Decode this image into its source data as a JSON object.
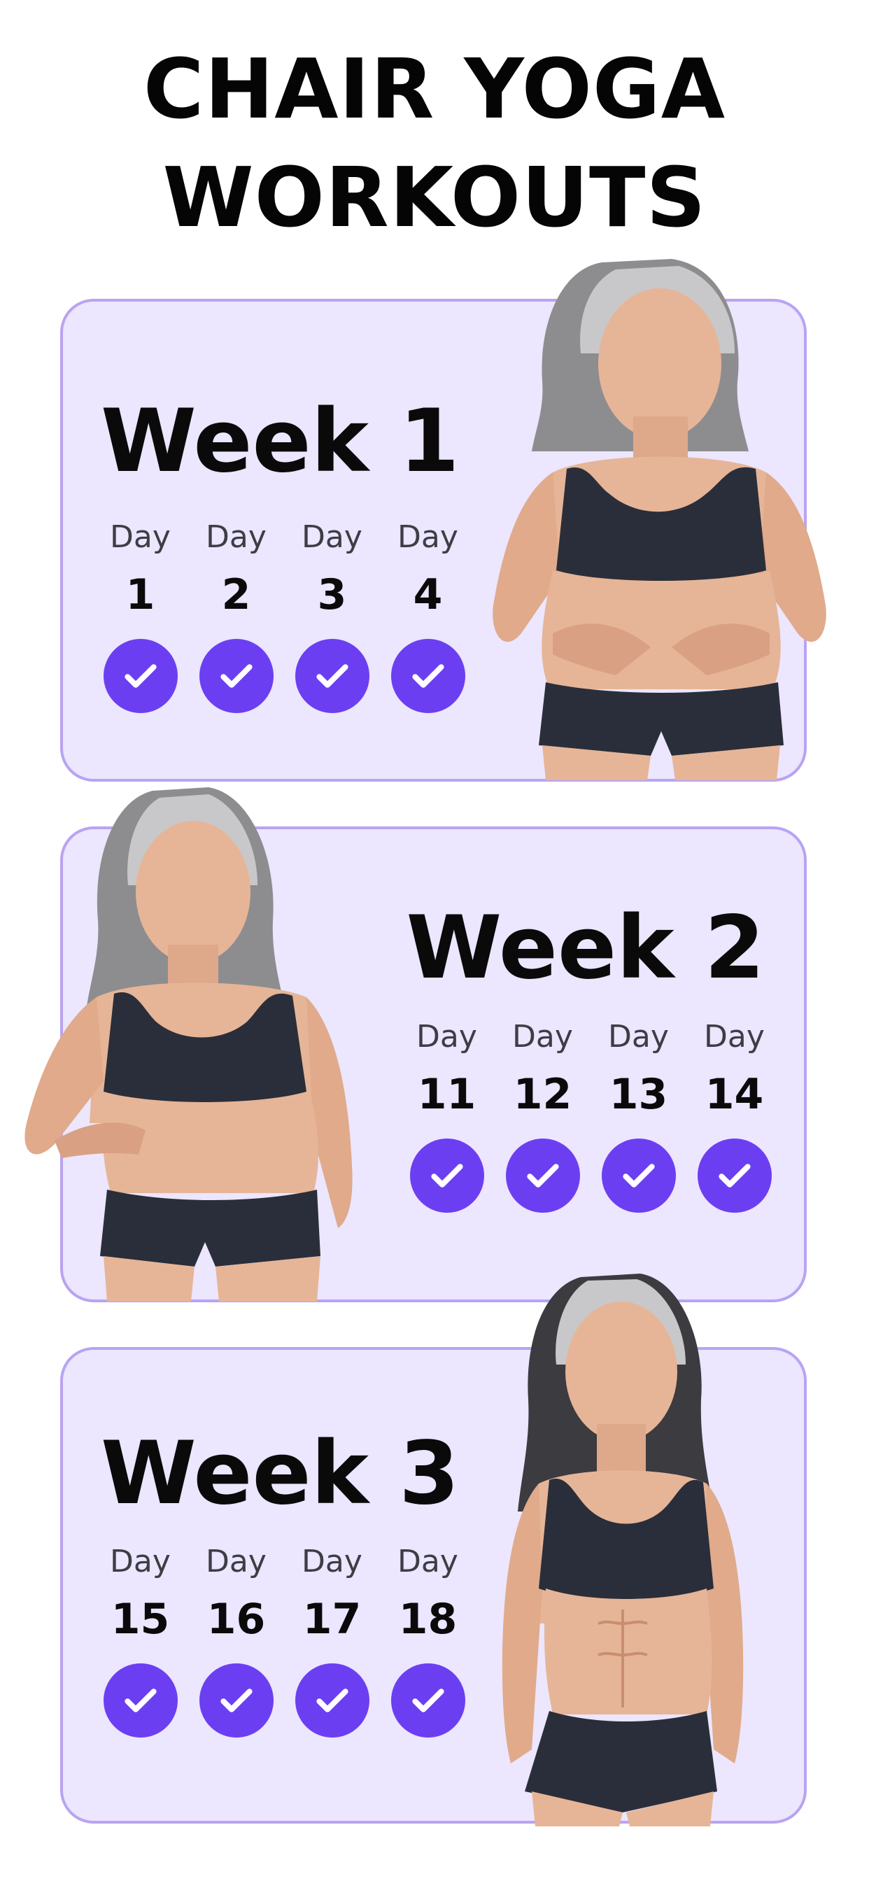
{
  "header": {
    "title_line1": "CHAIR YOGA",
    "title_line2": "WORKOUTS"
  },
  "colors": {
    "card_bg": "#ece6fe",
    "card_border": "#b9a3f2",
    "check_bg": "#6b3ff1",
    "text": "#0a0a0a"
  },
  "weeks": [
    {
      "title": "Week 1",
      "days": [
        {
          "label": "Day",
          "number": "1",
          "completed": true
        },
        {
          "label": "Day",
          "number": "2",
          "completed": true
        },
        {
          "label": "Day",
          "number": "3",
          "completed": true
        },
        {
          "label": "Day",
          "number": "4",
          "completed": true
        }
      ]
    },
    {
      "title": "Week 2",
      "days": [
        {
          "label": "Day",
          "number": "11",
          "completed": true
        },
        {
          "label": "Day",
          "number": "12",
          "completed": true
        },
        {
          "label": "Day",
          "number": "13",
          "completed": true
        },
        {
          "label": "Day",
          "number": "14",
          "completed": true
        }
      ]
    },
    {
      "title": "Week 3",
      "days": [
        {
          "label": "Day",
          "number": "15",
          "completed": true
        },
        {
          "label": "Day",
          "number": "16",
          "completed": true
        },
        {
          "label": "Day",
          "number": "17",
          "completed": true
        },
        {
          "label": "Day",
          "number": "18",
          "completed": true
        }
      ]
    }
  ],
  "icons": {
    "check": "checkmark-icon"
  }
}
